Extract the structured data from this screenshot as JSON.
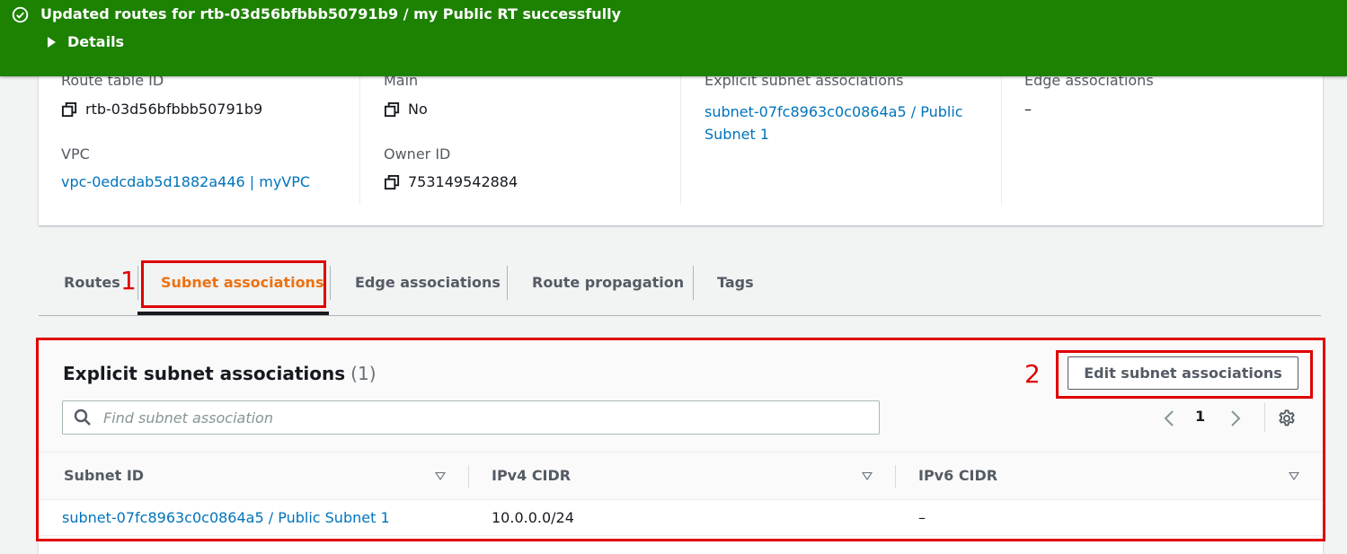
{
  "flash": {
    "message": "Updated routes for rtb-03d56bfbbb50791b9 / my Public RT successfully",
    "details_label": "Details",
    "color": "#1d8102"
  },
  "details": {
    "route_table_id": {
      "label": "Route table ID",
      "value": "rtb-03d56bfbbb50791b9"
    },
    "vpc": {
      "label": "VPC",
      "value": "vpc-0edcdab5d1882a446 | myVPC"
    },
    "main": {
      "label": "Main",
      "value": "No"
    },
    "owner_id": {
      "label": "Owner ID",
      "value": "753149542884"
    },
    "explicit_subnet_associations": {
      "label": "Explicit subnet associations",
      "value_line1": "subnet-07fc8963c0c0864a5 / Public",
      "value_line2": "Subnet 1"
    },
    "edge_associations": {
      "label": "Edge associations",
      "value": "–"
    }
  },
  "tabs": [
    {
      "label": "Routes"
    },
    {
      "label": "Subnet associations",
      "active": true
    },
    {
      "label": "Edge associations"
    },
    {
      "label": "Route propagation"
    },
    {
      "label": "Tags"
    }
  ],
  "annotations": {
    "one": "1",
    "two": "2",
    "color": "#e00000"
  },
  "table": {
    "title": "Explicit subnet associations",
    "count": "(1)",
    "edit_button": "Edit subnet associations",
    "search_placeholder": "Find subnet association",
    "page": "1",
    "columns": [
      "Subnet ID",
      "IPv4 CIDR",
      "IPv6 CIDR"
    ],
    "rows": [
      {
        "subnet_id": "subnet-07fc8963c0c0864a5 / Public Subnet 1",
        "ipv4_cidr": "10.0.0.0/24",
        "ipv6_cidr": "–"
      }
    ]
  },
  "icons": {
    "flash": "check-circle-icon",
    "copy": "copy-icon",
    "search": "search-icon",
    "prev": "chevron-left-icon",
    "next": "chevron-right-icon",
    "settings": "gear-icon",
    "sort": "sort-caret-down-icon"
  },
  "colors": {
    "accent": "#ec7211",
    "link": "#0073bb"
  }
}
